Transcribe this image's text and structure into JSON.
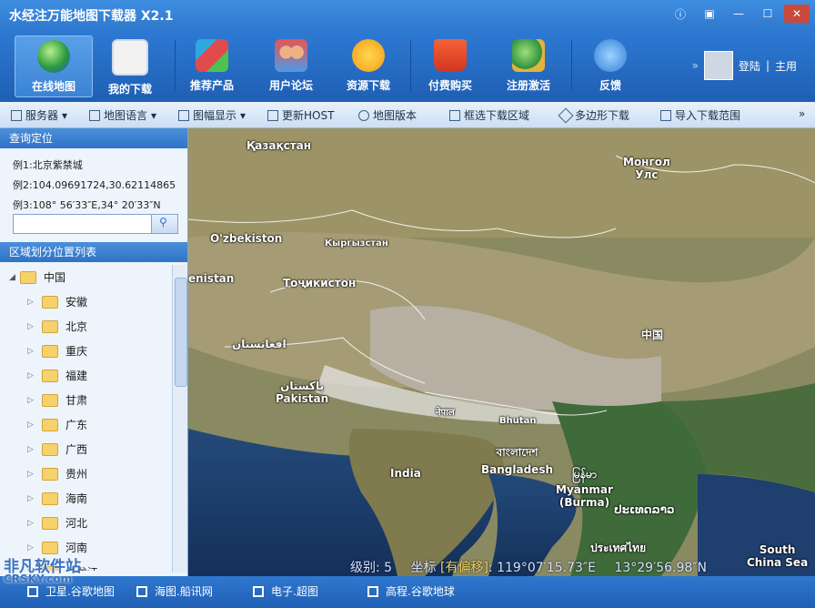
{
  "window": {
    "title": "水经注万能地图下载器 X2.1"
  },
  "toolbar": {
    "items": [
      {
        "label": "在线地图"
      },
      {
        "label": "我的下载"
      },
      {
        "label": "推荐产品"
      },
      {
        "label": "用户论坛"
      },
      {
        "label": "资源下载"
      },
      {
        "label": "付费购买"
      },
      {
        "label": "注册激活"
      },
      {
        "label": "反馈"
      }
    ],
    "login": "登陆",
    "home": "主用"
  },
  "menubar": {
    "items": [
      {
        "label": "服务器"
      },
      {
        "label": "地图语言"
      },
      {
        "label": "图幅显示"
      },
      {
        "label": "更新HOST"
      },
      {
        "label": "地图版本"
      },
      {
        "label": "框选下载区域"
      },
      {
        "label": "多边形下载"
      },
      {
        "label": "导入下载范围"
      }
    ]
  },
  "left": {
    "query_title": "查询定位",
    "examples": [
      "例1:北京紫禁城",
      "例2:104.09691724,30.62114865",
      "例3:108° 56′33″E,34° 20′33″N"
    ],
    "search_placeholder": "",
    "region_title": "区域划分位置列表",
    "root": "中国",
    "provinces": [
      "安徽",
      "北京",
      "重庆",
      "福建",
      "甘肃",
      "广东",
      "广西",
      "贵州",
      "海南",
      "河北",
      "河南",
      "黑龙江"
    ]
  },
  "map": {
    "labels": [
      "Қазақстан",
      "Монгол\nУлс",
      "O'zbekiston",
      "Кыргызстан",
      "Тоҷикистон",
      "enistan",
      "افغانستان",
      "پاکستان\nPakistan",
      "中国",
      "नेपाल",
      "Bhutan",
      "বাংলাদেশ\nBangladesh",
      "India",
      "မြန်မာ\nMyanmar\n(Burma)",
      "ປະເທດລາວ",
      "ประเทศไทย",
      "South\nChina Sea"
    ],
    "status": {
      "level_label": "级别:",
      "level_value": "5",
      "coord_label": "坐标",
      "coord_tag": "[有偏移]",
      "lon": "119°07′15.73″E",
      "lat": "13°29′56.98″N"
    }
  },
  "bottom": {
    "items": [
      {
        "label": "卫星.谷歌地图"
      },
      {
        "label": "海图.船讯网"
      },
      {
        "label": "电子.超图"
      },
      {
        "label": "高程.谷歌地球"
      }
    ]
  },
  "watermark": {
    "line1": "非凡软件站",
    "line2": "CRSKY.com"
  }
}
